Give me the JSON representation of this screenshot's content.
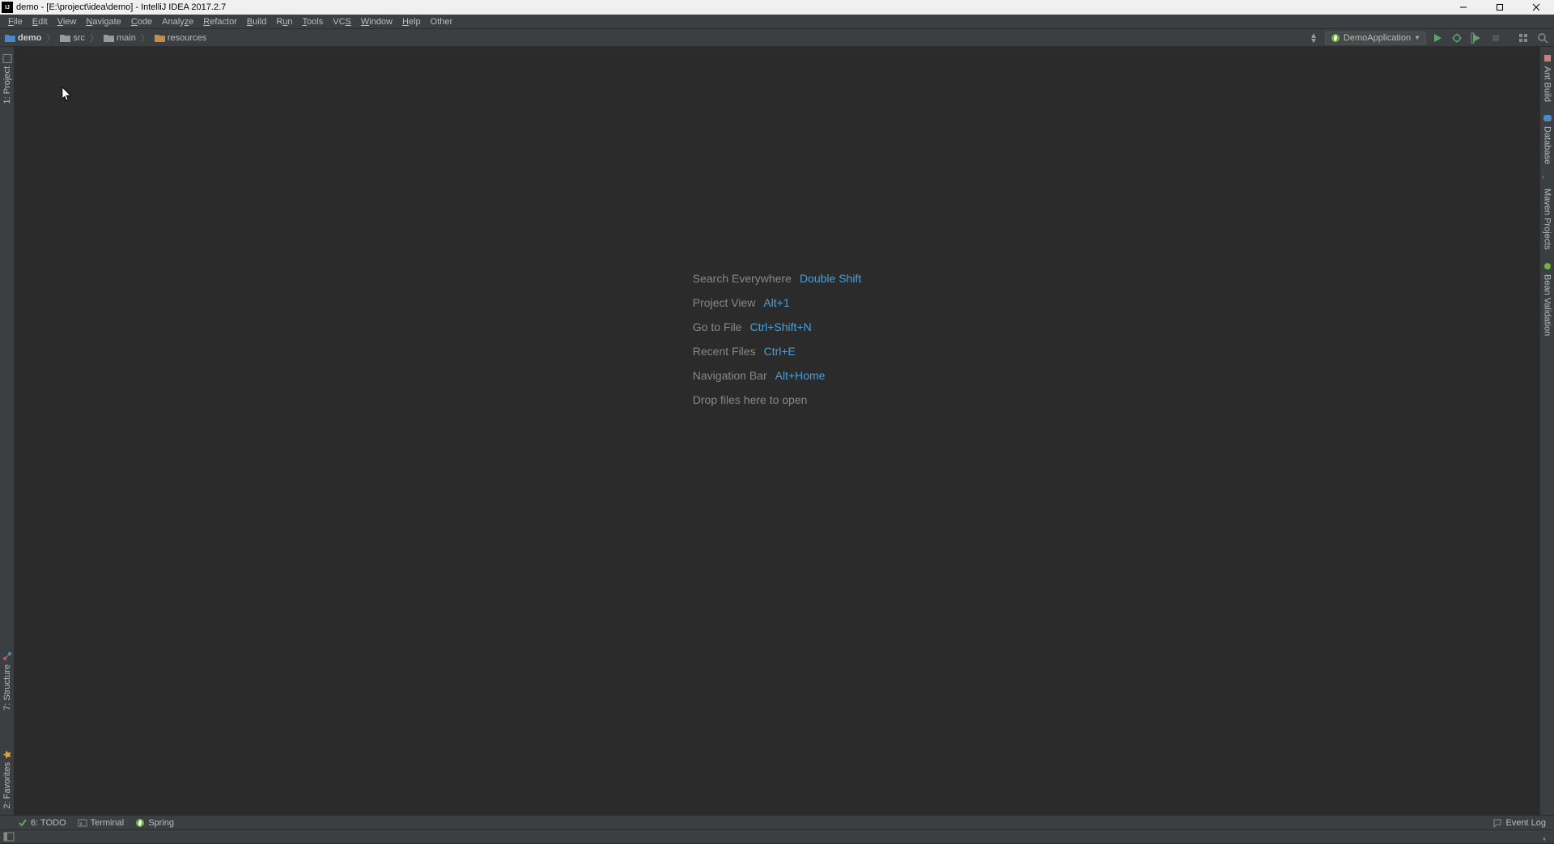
{
  "window": {
    "title": "demo - [E:\\project\\idea\\demo] - IntelliJ IDEA 2017.2.7"
  },
  "menu": {
    "items": [
      "File",
      "Edit",
      "View",
      "Navigate",
      "Code",
      "Analyze",
      "Refactor",
      "Build",
      "Run",
      "Tools",
      "VCS",
      "Window",
      "Help",
      "Other"
    ]
  },
  "breadcrumb": {
    "items": [
      {
        "label": "demo",
        "icon": "blue",
        "bold": true
      },
      {
        "label": "src",
        "icon": "gray",
        "bold": false
      },
      {
        "label": "main",
        "icon": "gray",
        "bold": false
      },
      {
        "label": "resources",
        "icon": "orange",
        "bold": false
      }
    ]
  },
  "run_config": {
    "name": "DemoApplication"
  },
  "left_tabs": {
    "top": [
      {
        "label": "1: Project"
      }
    ],
    "bottom": [
      {
        "label": "7: Structure"
      },
      {
        "label": "2: Favorites"
      }
    ]
  },
  "right_tabs": {
    "items": [
      {
        "label": "Ant Build"
      },
      {
        "label": "Database"
      },
      {
        "label": "Maven Projects"
      },
      {
        "label": "Bean Validation"
      }
    ]
  },
  "hints": {
    "rows": [
      {
        "label": "Search Everywhere",
        "shortcut": "Double Shift"
      },
      {
        "label": "Project View",
        "shortcut": "Alt+1"
      },
      {
        "label": "Go to File",
        "shortcut": "Ctrl+Shift+N"
      },
      {
        "label": "Recent Files",
        "shortcut": "Ctrl+E"
      },
      {
        "label": "Navigation Bar",
        "shortcut": "Alt+Home"
      }
    ],
    "drop_hint": "Drop files here to open"
  },
  "bottom_tabs": {
    "items": [
      {
        "label": "6: TODO",
        "icon": "todo"
      },
      {
        "label": "Terminal",
        "icon": "terminal"
      },
      {
        "label": "Spring",
        "icon": "spring"
      }
    ],
    "event_log": "Event Log"
  },
  "colors": {
    "accent": "#4a9fd8",
    "run_green": "#59a869",
    "debug_green": "#59a869",
    "stop_gray": "#555555"
  }
}
